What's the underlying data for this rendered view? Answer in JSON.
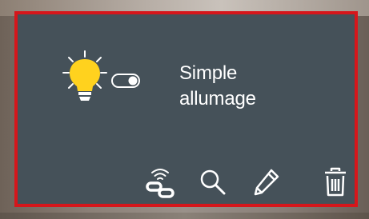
{
  "device": {
    "name_line1": "Simple",
    "name_line2": "allumage",
    "state": "on",
    "bulb_color": "#ffd21e",
    "toggle_state": "on"
  },
  "actions": [
    {
      "icon": "wireless-link-icon"
    },
    {
      "icon": "search-icon"
    },
    {
      "icon": "pencil-icon"
    },
    {
      "icon": "trash-icon"
    }
  ],
  "colors": {
    "card_background": "#455159",
    "card_border": "#d6161b",
    "text": "#ffffff",
    "icon": "#ffffff"
  }
}
